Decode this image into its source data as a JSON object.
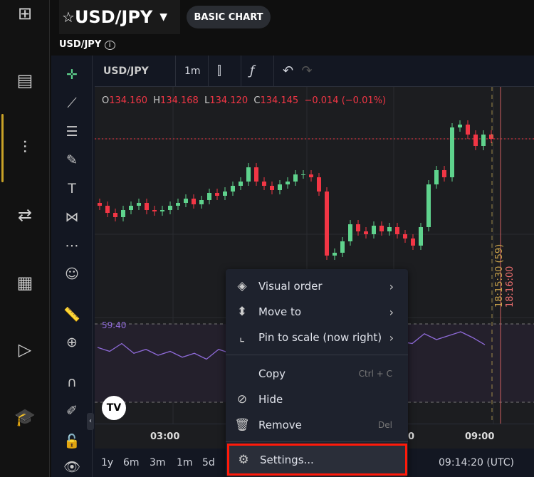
{
  "nav": {
    "items": [
      "layout-grid-icon",
      "screener-icon",
      "chart-compare-icon",
      "swap-icon",
      "news-icon",
      "video-icon",
      "education-icon"
    ],
    "active_index": 2,
    "accent": "#c9a227"
  },
  "header": {
    "symbol": "USD/JPY",
    "basic_chart": "BASIC CHART",
    "subtitle": "USD/JPY"
  },
  "toolbar": {
    "symbol": "USD/JPY",
    "interval": "1m"
  },
  "ohlc": {
    "o_label": "O",
    "o": "134.160",
    "h_label": "H",
    "h": "134.168",
    "l_label": "L",
    "l": "134.120",
    "c_label": "C",
    "c": "134.145",
    "change": "−0.014 (−0.01%)"
  },
  "chart_data": {
    "type": "candlestick",
    "closes": [
      134.098,
      134.093,
      134.09,
      134.095,
      134.098,
      134.1,
      134.095,
      134.094,
      134.095,
      134.098,
      134.1,
      134.103,
      134.099,
      134.102,
      134.107,
      134.105,
      134.108,
      134.112,
      134.115,
      134.125,
      134.115,
      134.112,
      134.109,
      134.113,
      134.115,
      134.12,
      134.12,
      134.118,
      134.108,
      134.063,
      134.065,
      134.073,
      134.085,
      134.08,
      134.078,
      134.084,
      134.08,
      134.083,
      134.078,
      134.075,
      134.07,
      134.083,
      134.113,
      134.123,
      134.118,
      134.153,
      134.155,
      134.148,
      134.14,
      134.148,
      134.145
    ],
    "last_price": 134.145,
    "up_color": "#5fd38d",
    "down_color": "#f23645"
  },
  "rsi": {
    "value": "59.40",
    "values": [
      58,
      56,
      60,
      55,
      57,
      54,
      56,
      53,
      55,
      52,
      57,
      55,
      54,
      56,
      60,
      55,
      57,
      58,
      56,
      55,
      57,
      54,
      56,
      58,
      62,
      61,
      60,
      65,
      62,
      64,
      66,
      63,
      59.4
    ]
  },
  "markers": {
    "dashed": "18:15:30 (59)",
    "solid": "18:16:00"
  },
  "xaxis": {
    "labels": [
      "03:00",
      "09:00"
    ],
    "partial": "0"
  },
  "bottom": {
    "ranges": [
      "1y",
      "6m",
      "3m",
      "1m",
      "5d"
    ],
    "clock": "09:14:20 (UTC)"
  },
  "menu": {
    "items": [
      {
        "label": "Visual order",
        "icon": "layers-icon",
        "submenu": true
      },
      {
        "label": "Move to",
        "icon": "move-icon",
        "submenu": true
      },
      {
        "label": "Pin to scale (now right)",
        "icon": "pin-scale-icon",
        "submenu": true
      },
      {
        "label": "Copy",
        "shortcut": "Ctrl + C"
      },
      {
        "label": "Hide",
        "icon": "eye-off-icon"
      },
      {
        "label": "Remove",
        "icon": "trash-icon",
        "shortcut": "Del"
      },
      {
        "label": "Settings...",
        "icon": "gear-icon"
      }
    ]
  }
}
